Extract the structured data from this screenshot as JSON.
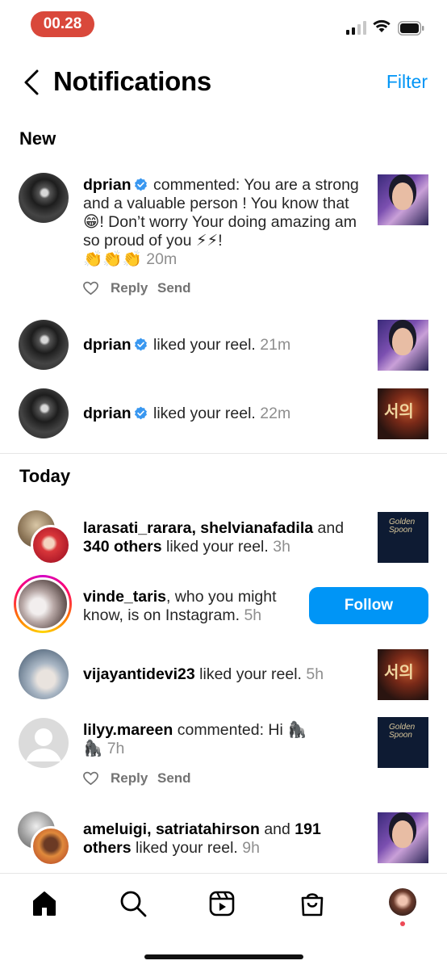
{
  "status_bar": {
    "time": "00.28"
  },
  "header": {
    "title": "Notifications",
    "filter_label": "Filter"
  },
  "sections": {
    "new": "New",
    "today": "Today"
  },
  "notifications_new": [
    {
      "username": "dprian",
      "verified": true,
      "message": "commented: You are a strong and a valuable person ! You know that 😁! Don’t worry Your doing amazing am so proud of you ⚡⚡!",
      "emoji_line": "👏👏👏",
      "time": "20m",
      "actions": {
        "reply": "Reply",
        "send": "Send"
      }
    },
    {
      "username": "dprian",
      "verified": true,
      "message": "liked your reel.",
      "time": "21m"
    },
    {
      "username": "dprian",
      "verified": true,
      "message": "liked your reel.",
      "time": "22m"
    }
  ],
  "notifications_today": [
    {
      "usernames": "larasati_rarara, shelvianafadila",
      "joiner": "and",
      "others": "340 others",
      "message": "liked your reel.",
      "time": "3h"
    },
    {
      "username": "vinde_taris",
      "message": ", who you might know, is on Instagram.",
      "time": "5h",
      "button": "Follow"
    },
    {
      "username": "vijayantidevi23",
      "message": "liked your reel.",
      "time": "5h"
    },
    {
      "username": "lilyy.mareen",
      "message": "commented: Hi 🦍",
      "emoji_line": "🦍",
      "time": "7h",
      "actions": {
        "reply": "Reply",
        "send": "Send"
      }
    },
    {
      "usernames": "ameluigi, satriatahirson",
      "joiner": "and",
      "others": "191 others",
      "message": "liked your reel.",
      "time": "9h"
    }
  ],
  "thumb_text": {
    "red_glyph": "서의",
    "navy_line1": "Golden",
    "navy_line2": "Spoon"
  },
  "nav": [
    "home-icon",
    "search-icon",
    "reels-icon",
    "shop-icon",
    "profile-avatar"
  ],
  "colors": {
    "accent": "#0095f6",
    "time_pill": "#d9483b",
    "notification_dot": "#ed4956"
  }
}
